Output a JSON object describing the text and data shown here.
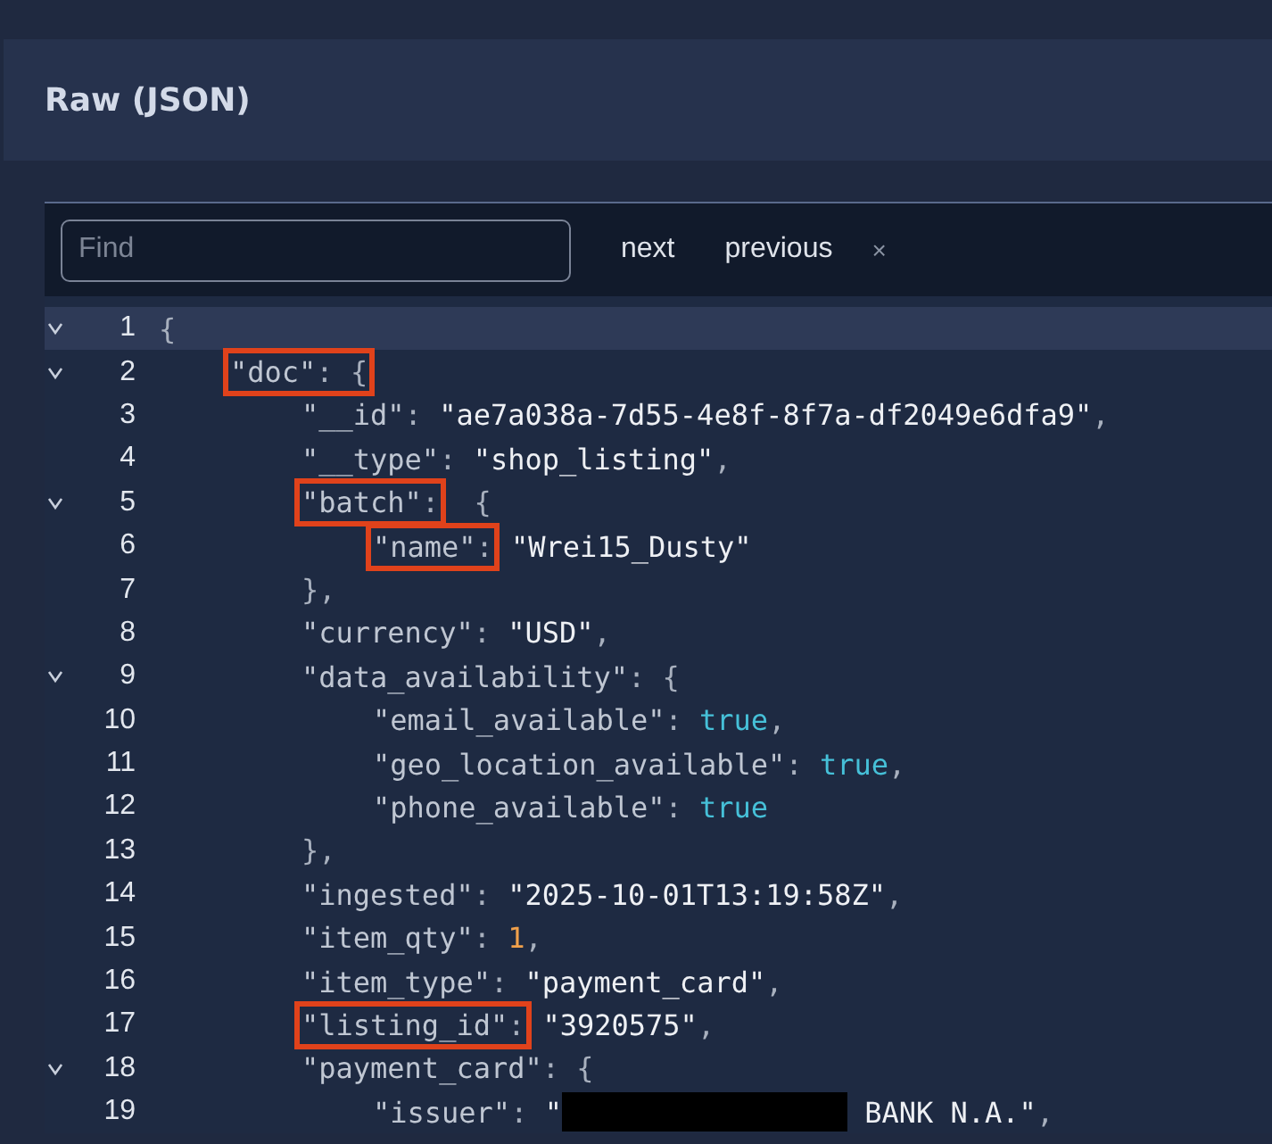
{
  "panel": {
    "title": "Raw (JSON)"
  },
  "find": {
    "placeholder": "Find",
    "buttons": [
      "next",
      "previous"
    ],
    "close": "×"
  },
  "lines": [
    {
      "num": "1",
      "expanded": true,
      "selected": true,
      "tokens": [
        {
          "kind": "punct",
          "text": "{"
        }
      ],
      "children": [
        {
          "num": "2",
          "expanded": true,
          "selected": false,
          "tokens": [
            {
              "kind": "key",
              "text": "\"doc\"",
              "boxed": true
            },
            {
              "kind": "punct",
              "text": ": {",
              "boxed": true
            }
          ],
          "children": [
            {
              "num": "3",
              "selected": false,
              "tokens": [
                {
                  "kind": "key",
                  "text": "\"__id\""
                },
                {
                  "kind": "punct",
                  "text": ": "
                },
                {
                  "kind": "string",
                  "text": "\"ae7a038a-7d55-4e8f-8f7a-df2049e6dfa9\""
                },
                {
                  "kind": "punct",
                  "text": ","
                }
              ]
            },
            {
              "num": "4",
              "selected": false,
              "tokens": [
                {
                  "kind": "key",
                  "text": "\"__type\""
                },
                {
                  "kind": "punct",
                  "text": ": "
                },
                {
                  "kind": "string",
                  "text": "\"shop_listing\""
                },
                {
                  "kind": "punct",
                  "text": ","
                }
              ]
            },
            {
              "num": "5",
              "expanded": true,
              "selected": false,
              "tokens": [
                {
                  "kind": "key",
                  "text": "\"batch\"",
                  "boxed": true
                },
                {
                  "kind": "punct",
                  "text": ":",
                  "boxed": true
                },
                {
                  "kind": "punct",
                  "text": " {"
                }
              ],
              "children": [
                {
                  "num": "6",
                  "selected": false,
                  "tokens": [
                    {
                      "kind": "key",
                      "text": "\"name\"",
                      "boxed": true
                    },
                    {
                      "kind": "punct",
                      "text": ":",
                      "boxed": true
                    },
                    {
                      "kind": "string",
                      "text": "\"Wrei15_Dusty\""
                    }
                  ]
                }
              ]
            },
            {
              "num": "7",
              "selected": false,
              "tokens": [
                {
                  "kind": "punct",
                  "text": "},"
                }
              ]
            },
            {
              "num": "8",
              "selected": false,
              "tokens": [
                {
                  "kind": "key",
                  "text": "\"currency\""
                },
                {
                  "kind": "punct",
                  "text": ": "
                },
                {
                  "kind": "string",
                  "text": "\"USD\""
                },
                {
                  "kind": "punct",
                  "text": ","
                }
              ]
            },
            {
              "num": "9",
              "expanded": true,
              "selected": false,
              "tokens": [
                {
                  "kind": "key",
                  "text": "\"data_availability\""
                },
                {
                  "kind": "punct",
                  "text": ": {"
                }
              ],
              "children": [
                {
                  "num": "10",
                  "selected": false,
                  "tokens": [
                    {
                      "kind": "key",
                      "text": "\"email_available\""
                    },
                    {
                      "kind": "punct",
                      "text": ": "
                    },
                    {
                      "kind": "bool",
                      "text": "true"
                    },
                    {
                      "kind": "punct",
                      "text": ","
                    }
                  ]
                },
                {
                  "num": "11",
                  "selected": false,
                  "tokens": [
                    {
                      "kind": "key",
                      "text": "\"geo_location_available\""
                    },
                    {
                      "kind": "punct",
                      "text": ": "
                    },
                    {
                      "kind": "bool",
                      "text": "true"
                    },
                    {
                      "kind": "punct",
                      "text": ","
                    }
                  ]
                },
                {
                  "num": "12",
                  "selected": false,
                  "tokens": [
                    {
                      "kind": "key",
                      "text": "\"phone_available\""
                    },
                    {
                      "kind": "punct",
                      "text": ": "
                    },
                    {
                      "kind": "bool",
                      "text": "true"
                    }
                  ]
                }
              ]
            },
            {
              "num": "13",
              "selected": false,
              "tokens": [
                {
                  "kind": "punct",
                  "text": "},"
                }
              ]
            },
            {
              "num": "14",
              "selected": false,
              "tokens": [
                {
                  "kind": "key",
                  "text": "\"ingested\""
                },
                {
                  "kind": "punct",
                  "text": ": "
                },
                {
                  "kind": "string",
                  "text": "\"2025-10-01T13:19:58Z\""
                },
                {
                  "kind": "punct",
                  "text": ","
                }
              ]
            },
            {
              "num": "15",
              "selected": false,
              "tokens": [
                {
                  "kind": "key",
                  "text": "\"item_qty\""
                },
                {
                  "kind": "punct",
                  "text": ": "
                },
                {
                  "kind": "number",
                  "text": "1"
                },
                {
                  "kind": "punct",
                  "text": ","
                }
              ]
            },
            {
              "num": "16",
              "selected": false,
              "tokens": [
                {
                  "kind": "key",
                  "text": "\"item_type\""
                },
                {
                  "kind": "punct",
                  "text": ": "
                },
                {
                  "kind": "string",
                  "text": "\"payment_card\""
                },
                {
                  "kind": "punct",
                  "text": ","
                }
              ]
            },
            {
              "num": "17",
              "selected": false,
              "tokens": [
                {
                  "kind": "key",
                  "text": "\"listing_id\"",
                  "boxed": true
                },
                {
                  "kind": "punct",
                  "text": ":",
                  "boxed": true
                },
                {
                  "kind": "string",
                  "text": "\"3920575\""
                },
                {
                  "kind": "punct",
                  "text": ","
                }
              ]
            },
            {
              "num": "18",
              "expanded": true,
              "selected": false,
              "tokens": [
                {
                  "kind": "key",
                  "text": "\"payment_card\""
                },
                {
                  "kind": "punct",
                  "text": ": {"
                }
              ],
              "children": [
                {
                  "num": "19",
                  "selected": false,
                  "tokens": [
                    {
                      "kind": "key",
                      "text": "\"issuer\""
                    },
                    {
                      "kind": "punct",
                      "text": ": "
                    },
                    {
                      "kind": "string",
                      "text": "\""
                    },
                    {
                      "kind": "redacted"
                    },
                    {
                      "kind": "string",
                      "text": " BANK N.A.\""
                    },
                    {
                      "kind": "punct",
                      "text": ","
                    }
                  ]
                }
              ]
            }
          ]
        }
      ]
    }
  ]
}
